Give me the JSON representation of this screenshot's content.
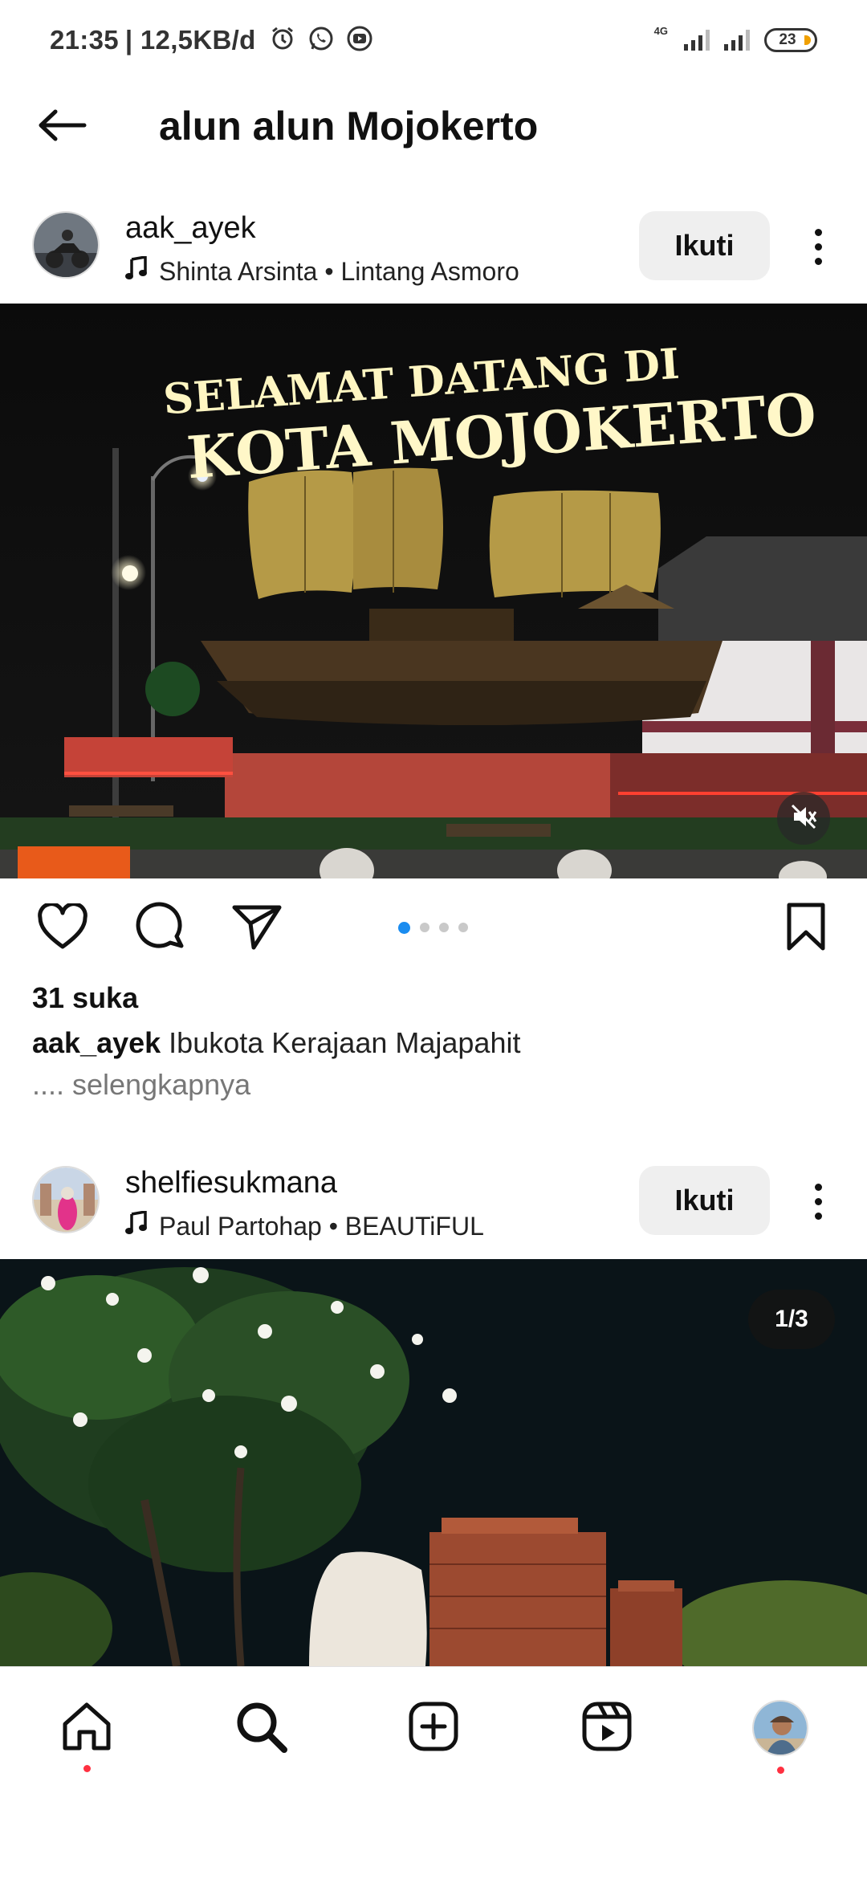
{
  "status_bar": {
    "time": "21:35",
    "speed": "| 12,5KB/d",
    "network": "4G",
    "battery": "23"
  },
  "header": {
    "title": "alun alun Mojokerto",
    "back_icon": "arrow-left-icon"
  },
  "posts": [
    {
      "username": "aak_ayek",
      "music": "Shinta Arsinta • Lintang Asmoro",
      "follow_label": "Ikuti",
      "image_text_line1": "SELAMAT DATANG DI",
      "image_text_line2": "KOTA MOJOKERTO",
      "likes": "31 suka",
      "caption_user": "aak_ayek",
      "caption_text": " Ibukota Kerajaan Majapahit",
      "more_link": ".... selengkapnya",
      "carousel_count": 4,
      "carousel_active": 0
    },
    {
      "username": "shelfiesukmana",
      "music": "Paul Partohap • BEAUTiFUL",
      "follow_label": "Ikuti",
      "counter": "1/3"
    }
  ],
  "bottom_nav": {
    "items": [
      "home-icon",
      "search-icon",
      "add-post-icon",
      "reels-icon",
      "profile-avatar"
    ]
  },
  "colors": {
    "accent_blue": "#1a8cf0",
    "notification_red": "#ff3040",
    "follow_button_bg": "#efefef"
  }
}
